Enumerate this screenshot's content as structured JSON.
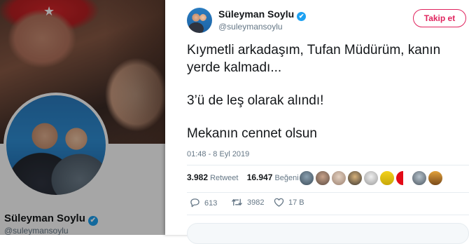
{
  "background_profile": {
    "name": "Süleyman Soylu",
    "handle": "@suleymansoylu",
    "verified_glyph": "✔"
  },
  "tweet": {
    "author_name": "Süleyman Soylu",
    "author_handle": "@suleymansoylu",
    "verified_glyph": "✔",
    "follow_label": "Takip et",
    "paragraphs": [
      "Kıymetli arkadaşım, Tufan Müdürüm, kanın yerde kalmadı...",
      "3’ü de leş olarak alındı!",
      "Mekanın cennet olsun"
    ],
    "timestamp": "01:48 - 8 Eyl 2019",
    "retweet_count": "3.982",
    "retweet_label": "Retweet",
    "like_count": "16.947",
    "like_label": "Beğeni",
    "actions": {
      "reply_count": "613",
      "retweet_count": "3982",
      "like_count": "17 B"
    }
  },
  "icons": [
    "reply-icon",
    "retweet-icon",
    "heart-icon",
    "verified-badge-icon"
  ],
  "colors": {
    "accent": "#e0245e",
    "verified": "#1da1f2",
    "muted_text": "#657786",
    "primary_text": "#14171a"
  }
}
